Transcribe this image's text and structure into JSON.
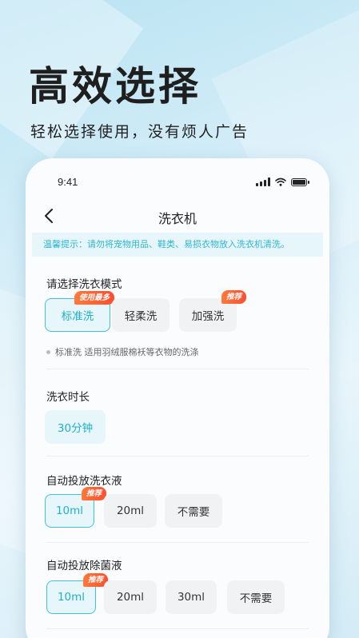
{
  "promo": {
    "headline": "高效选择",
    "subline": "轻松选择使用，没有烦人广告"
  },
  "status_bar": {
    "time": "9:41"
  },
  "nav": {
    "title": "洗衣机"
  },
  "notice": "温馨提示：请勿将宠物用品、鞋类、易损衣物放入洗衣机清洗。",
  "mode": {
    "title": "请选择洗衣模式",
    "options": [
      {
        "label": "标准洗",
        "badge": "使用最多",
        "selected": true
      },
      {
        "label": "轻柔洗",
        "badge": "",
        "selected": false
      },
      {
        "label": "加强洗",
        "badge": "推荐",
        "selected": false
      }
    ],
    "hint": "标准洗  适用羽绒服棉袄等衣物的洗涤"
  },
  "duration": {
    "title": "洗衣时长",
    "options": [
      {
        "label": "30分钟",
        "selected": true
      }
    ]
  },
  "detergent": {
    "title": "自动投放洗衣液",
    "options": [
      {
        "label": "10ml",
        "badge": "推荐",
        "selected": true
      },
      {
        "label": "20ml",
        "selected": false
      },
      {
        "label": "不需要",
        "selected": false
      }
    ]
  },
  "sanitizer": {
    "title": "自动投放除菌液",
    "options": [
      {
        "label": "10ml",
        "badge": "推荐",
        "selected": true
      },
      {
        "label": "20ml",
        "selected": false
      },
      {
        "label": "30ml",
        "selected": false
      },
      {
        "label": "不需要",
        "selected": false
      }
    ]
  },
  "colors": {
    "accent": "#1fb0cd",
    "accent_bg": "#e6f6fb",
    "badge": "#ff5a2e"
  },
  "icons": {
    "back": "chevron-left-icon",
    "signal": "signal-icon",
    "wifi": "wifi-icon",
    "battery": "battery-icon"
  }
}
